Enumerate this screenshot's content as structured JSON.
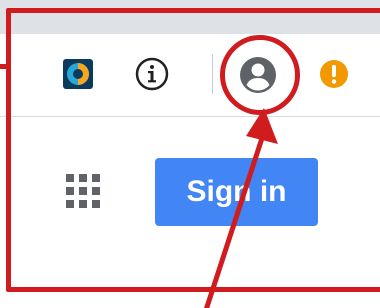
{
  "toolbar": {
    "extension_icon": "extension-icon",
    "info_icon": "info-icon",
    "profile_icon": "account-circle-icon",
    "warning_icon": "exclamation-warning-icon"
  },
  "page": {
    "apps_icon": "apps-grid-icon",
    "signin_label": "Sign in"
  },
  "annotation": {
    "highlight_target": "profile-avatar-button",
    "color": "#d01c1f"
  },
  "colors": {
    "signin_button": "#4285f4",
    "warning": "#f29900",
    "annotation": "#d01c1f"
  }
}
